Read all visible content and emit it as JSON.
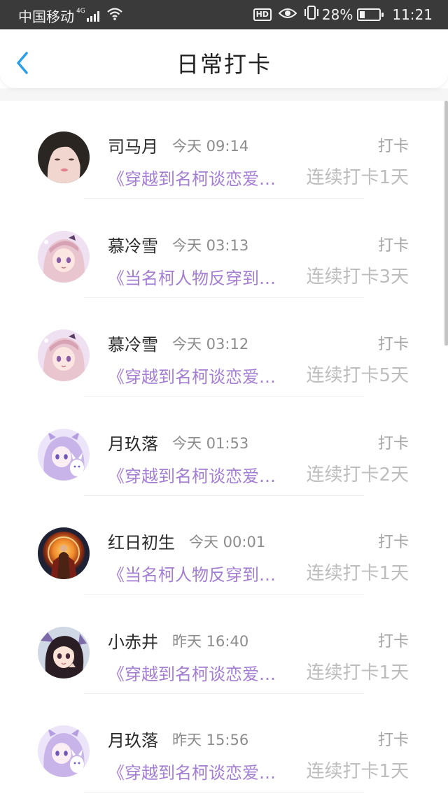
{
  "status_bar": {
    "carrier": "中国移动",
    "network": "4G",
    "battery": "28%",
    "battery_level": 0.28,
    "time": "11:21",
    "hd_label": "HD",
    "icons": [
      "signal-icon",
      "wifi-icon",
      "hd-icon",
      "eye-icon",
      "vibrate-icon",
      "battery-icon"
    ]
  },
  "header": {
    "title": "日常打卡",
    "back_icon": "chevron-left-icon",
    "accent": "#2a9fe6"
  },
  "colors": {
    "book_title": "#a47ed3",
    "streak": "#bdbdbd",
    "checkin": "#a5a5a5"
  },
  "entries": [
    {
      "name": "司马月",
      "time": "今天 09:14",
      "action": "打卡",
      "book": "《穿越到名柯谈恋爱…",
      "streak": "连续打卡1天",
      "avatar": "avatar-girl-photo"
    },
    {
      "name": "慕冷雪",
      "time": "今天 03:13",
      "action": "打卡",
      "book": "《当名柯人物反穿到…",
      "streak": "连续打卡3天",
      "avatar": "avatar-anime-pink"
    },
    {
      "name": "慕冷雪",
      "time": "今天 03:12",
      "action": "打卡",
      "book": "《穿越到名柯谈恋爱…",
      "streak": "连续打卡5天",
      "avatar": "avatar-anime-pink"
    },
    {
      "name": "月玖落",
      "time": "今天 01:53",
      "action": "打卡",
      "book": "《穿越到名柯谈恋爱…",
      "streak": "连续打卡2天",
      "avatar": "avatar-anime-purple"
    },
    {
      "name": "红日初生",
      "time": "今天 00:01",
      "action": "打卡",
      "book": "《当名柯人物反穿到…",
      "streak": "连续打卡1天",
      "avatar": "avatar-hero-fire"
    },
    {
      "name": "小赤井",
      "time": "昨天 16:40",
      "action": "打卡",
      "book": "《穿越到名柯谈恋爱…",
      "streak": "连续打卡1天",
      "avatar": "avatar-anime-darkhair"
    },
    {
      "name": "月玖落",
      "time": "昨天 15:56",
      "action": "打卡",
      "book": "《穿越到名柯谈恋爱…",
      "streak": "连续打卡1天",
      "avatar": "avatar-anime-purple"
    }
  ]
}
